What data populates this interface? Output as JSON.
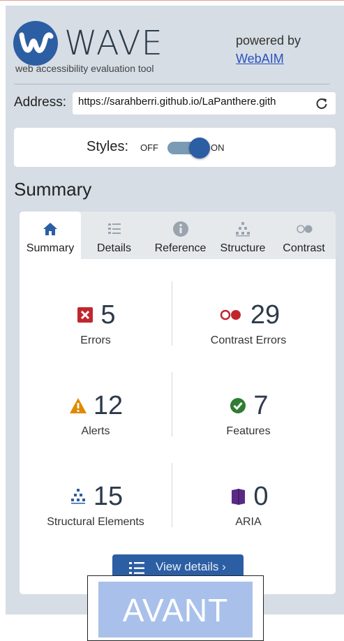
{
  "header": {
    "logo_text": "WAVE",
    "tagline": "web accessibility evaluation tool",
    "powered_by": "powered by",
    "webaim_link": "WebAIM"
  },
  "address": {
    "label": "Address:",
    "value": "https://sarahberri.github.io/LaPanthere.gith"
  },
  "styles": {
    "label": "Styles:",
    "off": "OFF",
    "on": "ON",
    "state": "on"
  },
  "summary_heading": "Summary",
  "tabs": [
    {
      "label": "Summary",
      "icon": "home-icon",
      "active": true
    },
    {
      "label": "Details",
      "icon": "list-icon",
      "active": false
    },
    {
      "label": "Reference",
      "icon": "info-icon",
      "active": false
    },
    {
      "label": "Structure",
      "icon": "structure-icon",
      "active": false
    },
    {
      "label": "Contrast",
      "icon": "contrast-icon",
      "active": false
    }
  ],
  "stats": {
    "errors": {
      "count": "5",
      "label": "Errors",
      "icon": "error-icon"
    },
    "contrast_errors": {
      "count": "29",
      "label": "Contrast Errors",
      "icon": "contrast-error-icon"
    },
    "alerts": {
      "count": "12",
      "label": "Alerts",
      "icon": "alert-icon"
    },
    "features": {
      "count": "7",
      "label": "Features",
      "icon": "feature-check-icon"
    },
    "structural": {
      "count": "15",
      "label": "Structural Elements",
      "icon": "structure-icon"
    },
    "aria": {
      "count": "0",
      "label": "ARIA",
      "icon": "aria-icon"
    }
  },
  "view_details": "View details ›",
  "overlay_label": "AVANT",
  "colors": {
    "brand_blue": "#2c5ea3",
    "error_red": "#c0272d",
    "alert_orange": "#e08a00",
    "feature_green": "#2e7d32",
    "aria_purple": "#5a2a86",
    "panel_bg": "#d6dde4",
    "overlay_blue": "#a9c1ea"
  }
}
